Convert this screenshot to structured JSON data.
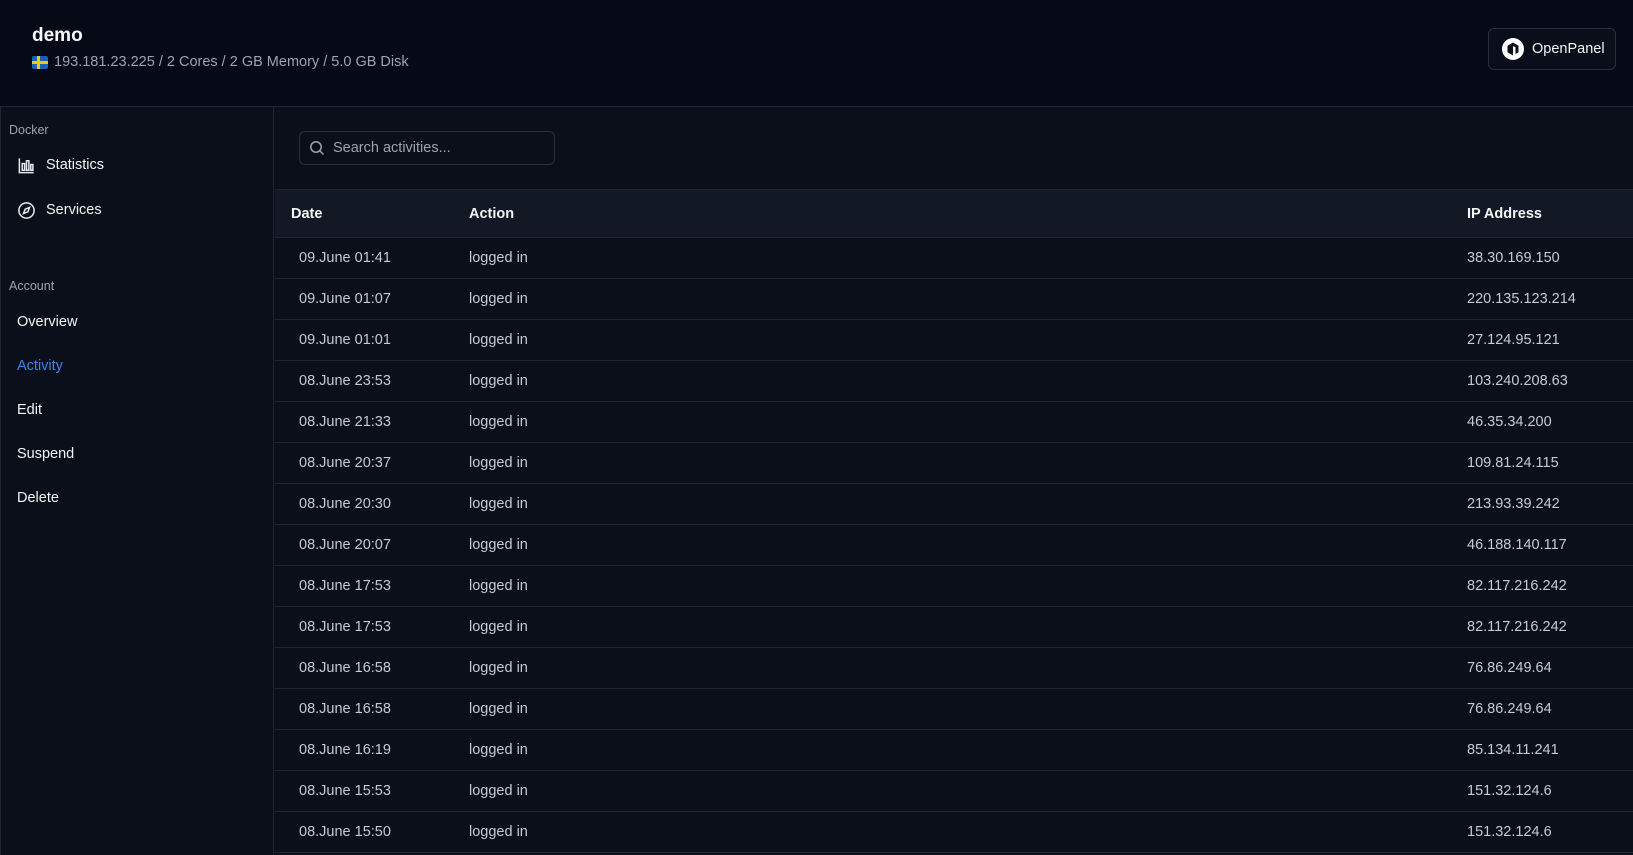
{
  "header": {
    "title": "demo",
    "server_info": "193.181.23.225 / 2 Cores / 2 GB Memory / 5.0 GB Disk",
    "brand_label": "OpenPanel"
  },
  "sidebar": {
    "docker_section": "Docker",
    "docker_items": [
      {
        "label": "Statistics",
        "icon": "bar-chart-icon"
      },
      {
        "label": "Services",
        "icon": "compass-icon"
      }
    ],
    "account_section": "Account",
    "account_items": [
      {
        "label": "Overview"
      },
      {
        "label": "Activity",
        "active": true
      },
      {
        "label": "Edit"
      },
      {
        "label": "Suspend"
      },
      {
        "label": "Delete"
      }
    ]
  },
  "search": {
    "placeholder": "Search activities..."
  },
  "table": {
    "columns": [
      "Date",
      "Action",
      "IP Address"
    ],
    "rows": [
      {
        "date": "09.June 01:41",
        "action": "logged in",
        "ip": "38.30.169.150"
      },
      {
        "date": "09.June 01:07",
        "action": "logged in",
        "ip": "220.135.123.214"
      },
      {
        "date": "09.June 01:01",
        "action": "logged in",
        "ip": "27.124.95.121"
      },
      {
        "date": "08.June 23:53",
        "action": "logged in",
        "ip": "103.240.208.63"
      },
      {
        "date": "08.June 21:33",
        "action": "logged in",
        "ip": "46.35.34.200"
      },
      {
        "date": "08.June 20:37",
        "action": "logged in",
        "ip": "109.81.24.115"
      },
      {
        "date": "08.June 20:30",
        "action": "logged in",
        "ip": "213.93.39.242"
      },
      {
        "date": "08.June 20:07",
        "action": "logged in",
        "ip": "46.188.140.117"
      },
      {
        "date": "08.June 17:53",
        "action": "logged in",
        "ip": "82.117.216.242"
      },
      {
        "date": "08.June 17:53",
        "action": "logged in",
        "ip": "82.117.216.242"
      },
      {
        "date": "08.June 16:58",
        "action": "logged in",
        "ip": "76.86.249.64"
      },
      {
        "date": "08.June 16:58",
        "action": "logged in",
        "ip": "76.86.249.64"
      },
      {
        "date": "08.June 16:19",
        "action": "logged in",
        "ip": "85.134.11.241"
      },
      {
        "date": "08.June 15:53",
        "action": "logged in",
        "ip": "151.32.124.6"
      },
      {
        "date": "08.June 15:50",
        "action": "logged in",
        "ip": "151.32.124.6"
      }
    ]
  },
  "colors": {
    "background": "#0b0f19",
    "header_bg": "#060a17",
    "accent": "#3b82f6",
    "border": "#1f2533"
  }
}
